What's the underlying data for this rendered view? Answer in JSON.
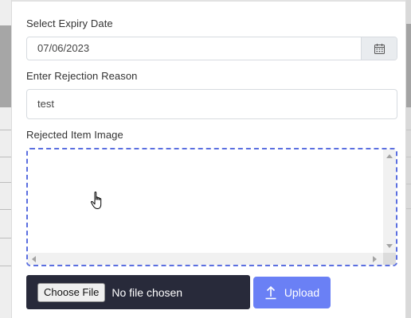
{
  "form": {
    "expiry": {
      "label": "Select Expiry Date",
      "value": "07/06/2023",
      "icon": "calendar-icon"
    },
    "reason": {
      "label": "Enter Rejection Reason",
      "value": "test"
    },
    "image": {
      "label": "Rejected Item Image",
      "border_color": "#5b6fe0"
    },
    "file_picker": {
      "button_label": "Choose File",
      "status": "No file chosen"
    },
    "upload": {
      "label": "Upload",
      "icon": "upload-arrow-icon",
      "color": "#6a80f5"
    }
  }
}
